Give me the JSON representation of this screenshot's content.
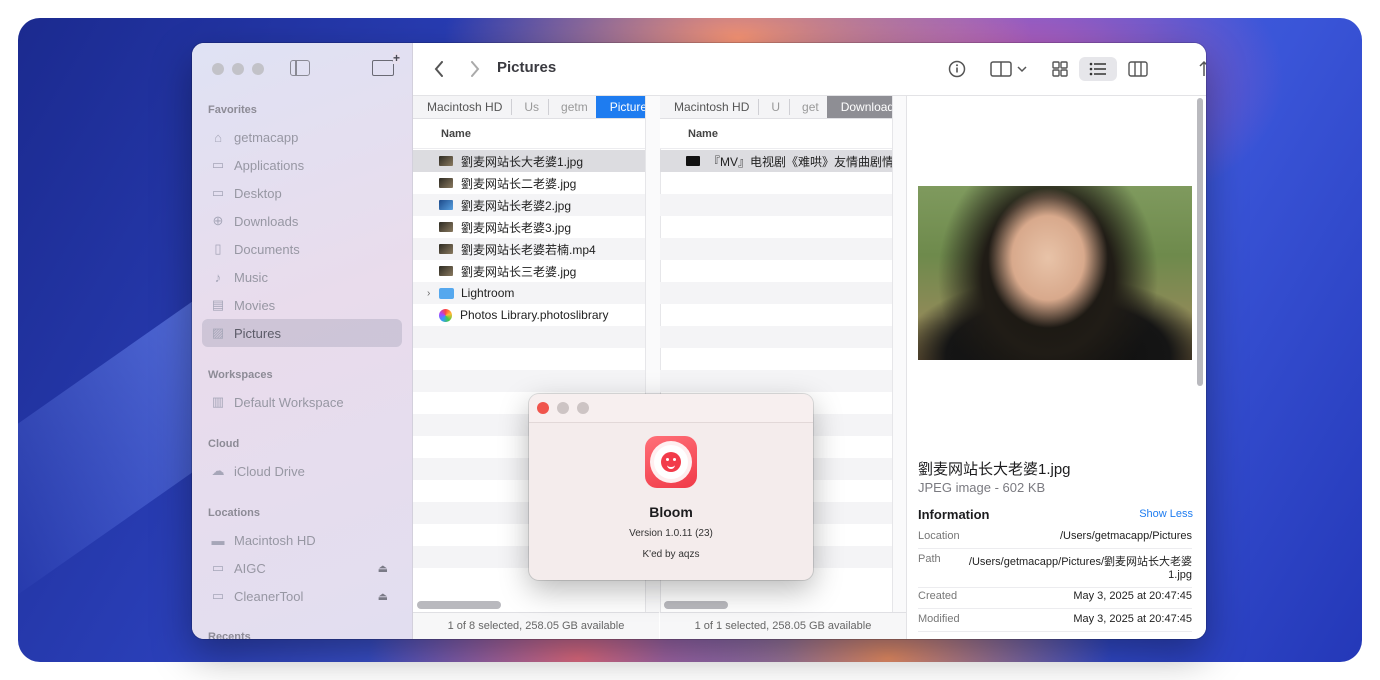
{
  "toolbar": {
    "title": "Pictures",
    "icons": [
      "chevron-left-icon",
      "chevron-right-icon",
      "info-icon",
      "preview-pane-icon",
      "grid-view-icon",
      "list-view-icon",
      "column-view-icon",
      "sort-icon",
      "group-icon",
      "share-icon",
      "badge-icon"
    ]
  },
  "sidebar": {
    "favorites_label": "Favorites",
    "favorites": [
      {
        "label": "getmacapp",
        "icon": "home-icon"
      },
      {
        "label": "Applications",
        "icon": "applications-icon"
      },
      {
        "label": "Desktop",
        "icon": "desktop-icon"
      },
      {
        "label": "Downloads",
        "icon": "downloads-icon"
      },
      {
        "label": "Documents",
        "icon": "documents-icon"
      },
      {
        "label": "Music",
        "icon": "music-icon"
      },
      {
        "label": "Movies",
        "icon": "movies-icon"
      },
      {
        "label": "Pictures",
        "icon": "pictures-icon",
        "selected": true
      }
    ],
    "workspaces_label": "Workspaces",
    "workspaces": [
      {
        "label": "Default Workspace"
      }
    ],
    "cloud_label": "Cloud",
    "cloud": [
      {
        "label": "iCloud Drive"
      }
    ],
    "locations_label": "Locations",
    "locations": [
      {
        "label": "Macintosh HD"
      },
      {
        "label": "AIGC"
      },
      {
        "label": "CleanerTool"
      }
    ],
    "recents_label": "Recents"
  },
  "pane1": {
    "path": [
      "Macintosh HD",
      "Us",
      "getm",
      "Pictures"
    ],
    "column_header": "Name",
    "files": [
      "劉麦网站长大老婆1.jpg",
      "劉麦网站长二老婆.jpg",
      "劉麦网站长老婆2.jpg",
      "劉麦网站长老婆3.jpg",
      "劉麦网站长老婆若楠.mp4",
      "劉麦网站长三老婆.jpg",
      "Lightroom",
      "Photos Library.photoslibrary"
    ],
    "status": "1 of 8 selected, 258.05 GB available"
  },
  "pane2": {
    "path": [
      "Macintosh HD",
      "U",
      "get",
      "Downloads"
    ],
    "column_header": "Name",
    "files": [
      "『MV』电视剧《难哄》友情曲剧情版"
    ],
    "status": "1 of 1 selected, 258.05 GB available"
  },
  "preview": {
    "name": "劉麦网站长大老婆1.jpg",
    "kind": "JPEG image - 602 KB",
    "info_label": "Information",
    "show_less": "Show Less",
    "location_label": "Location",
    "location_value": "/Users/getmacapp/Pictures",
    "path_label": "Path",
    "path_value": "/Users/getmacapp/Pictures/劉麦网站长大老婆1.jpg",
    "created_label": "Created",
    "created_value": "May 3, 2025 at 20:47:45",
    "modified_label": "Modified",
    "modified_value": "May 3, 2025 at 20:47:45"
  },
  "about": {
    "app_name": "Bloom",
    "version": "Version 1.0.11 (23)",
    "credit": "K'ed by aqzs"
  }
}
